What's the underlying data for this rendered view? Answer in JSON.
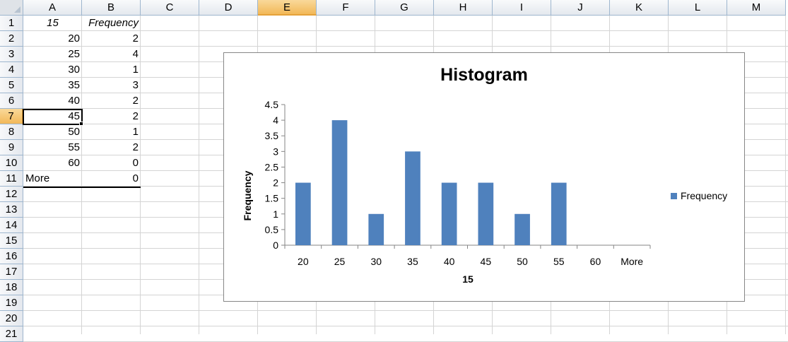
{
  "sheet": {
    "columns": [
      "A",
      "B",
      "C",
      "D",
      "E",
      "F",
      "G",
      "H",
      "I",
      "J",
      "K",
      "L",
      "M"
    ],
    "rows": [
      "1",
      "2",
      "3",
      "4",
      "5",
      "6",
      "7",
      "8",
      "9",
      "10",
      "11",
      "12",
      "13",
      "14",
      "15",
      "16",
      "17",
      "18",
      "19",
      "20",
      "21"
    ],
    "selected_column": "E",
    "selected_row": "7",
    "active_cell": "A7",
    "table": {
      "header": [
        "15",
        "Frequency"
      ],
      "rows": [
        [
          "20",
          "2"
        ],
        [
          "25",
          "4"
        ],
        [
          "30",
          "1"
        ],
        [
          "35",
          "3"
        ],
        [
          "40",
          "2"
        ],
        [
          "45",
          "2"
        ],
        [
          "50",
          "1"
        ],
        [
          "55",
          "2"
        ],
        [
          "60",
          "0"
        ],
        [
          "More",
          "0"
        ]
      ]
    }
  },
  "chart_data": {
    "type": "bar",
    "title": "Histogram",
    "xlabel": "15",
    "ylabel": "Frequency",
    "categories": [
      "20",
      "25",
      "30",
      "35",
      "40",
      "45",
      "50",
      "55",
      "60",
      "More"
    ],
    "series": [
      {
        "name": "Frequency",
        "values": [
          2,
          4,
          1,
          3,
          2,
          2,
          1,
          2,
          0,
          0
        ],
        "color": "#4f81bd"
      }
    ],
    "ylim": [
      0,
      4.5
    ],
    "yticks": [
      "0",
      "0.5",
      "1",
      "1.5",
      "2",
      "2.5",
      "3",
      "3.5",
      "4",
      "4.5"
    ],
    "grid": false,
    "legend": "right"
  }
}
